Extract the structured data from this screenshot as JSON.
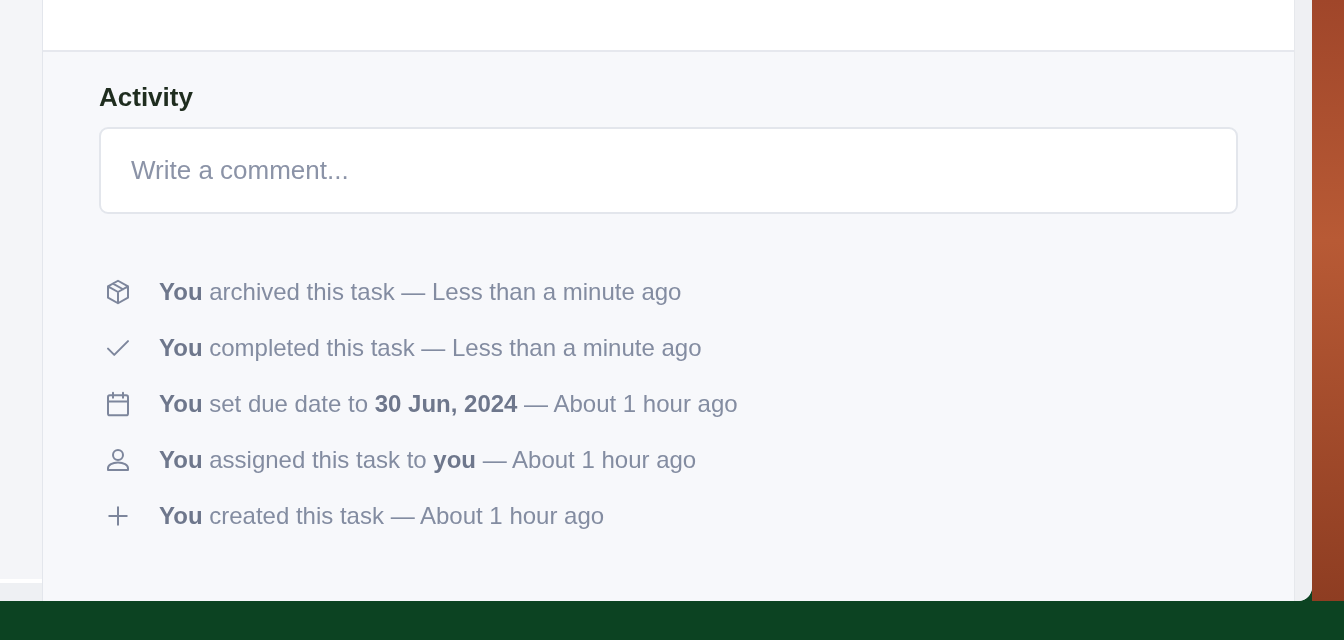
{
  "activity": {
    "title": "Activity",
    "comment": {
      "placeholder": "Write a comment..."
    },
    "items": [
      {
        "kind": "archive",
        "text": "**You** archived this task — Less than a minute ago"
      },
      {
        "kind": "complete",
        "text": "**You** completed this task — Less than a minute ago"
      },
      {
        "kind": "due",
        "text": "**You** set due date to **30 Jun, 2024** — About 1 hour ago"
      },
      {
        "kind": "assign",
        "text": "**You** assigned this task to **you** — About 1 hour ago"
      },
      {
        "kind": "create",
        "text": "**You** created this task — About 1 hour ago"
      }
    ]
  }
}
